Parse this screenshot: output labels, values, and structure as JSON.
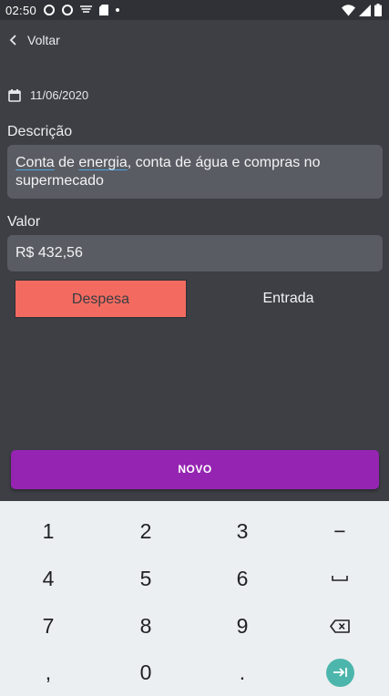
{
  "status_bar": {
    "time": "02:50",
    "left_icons": [
      "circle-notification-icon",
      "circle-notification-icon",
      "wifi-signal-icon",
      "sd-card-icon",
      "dot-icon"
    ],
    "right_icons": [
      "wifi-icon",
      "cell-signal-icon",
      "battery-icon"
    ]
  },
  "header": {
    "back_label": "Voltar",
    "back_icon": "chevron-left-icon"
  },
  "date": {
    "value": "11/06/2020",
    "icon": "calendar-icon"
  },
  "description": {
    "label": "Descrição",
    "value_parts": [
      "Conta",
      " de ",
      "energia",
      ", conta de água e compras no supermecado"
    ]
  },
  "amount": {
    "label": "Valor",
    "value": "R$ 432,56"
  },
  "type_toggle": {
    "expense_label": "Despesa",
    "income_label": "Entrada",
    "selected": "Despesa",
    "selected_color": "#f36b60"
  },
  "submit": {
    "label": "NOVO",
    "color": "#9524b2"
  },
  "keyboard": {
    "rows": [
      [
        "1",
        "2",
        "3",
        "−"
      ],
      [
        "4",
        "5",
        "6",
        "space-icon"
      ],
      [
        "7",
        "8",
        "9",
        "backspace-icon"
      ],
      [
        ",",
        "0",
        ".",
        "enter-icon"
      ]
    ],
    "accent": "#4db6ac"
  }
}
